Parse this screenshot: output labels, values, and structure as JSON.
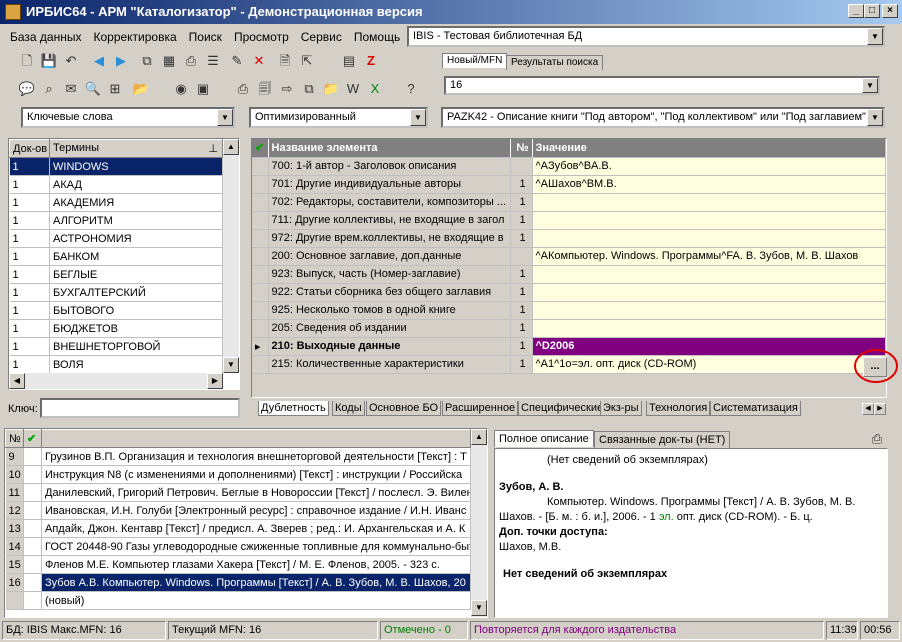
{
  "window": {
    "title": "ИРБИС64 - АРМ \"Каталогизатор\" - Демонстрационная версия"
  },
  "menu": [
    "База данных",
    "Корректировка",
    "Поиск",
    "Просмотр",
    "Сервис",
    "Помощь"
  ],
  "database": "IBIS - Тестовая библиотечная БД",
  "mfn_tabs": [
    "Новый/MFN",
    "Результаты поиска"
  ],
  "mfn_value": "16",
  "search_type": "Ключевые слова",
  "mode": "Оптимизированный",
  "worksheet": "PAZK42 - Описание книги \"Под автором\", \"Под коллективом\" или \"Под заглавием\"",
  "dict": {
    "headers": [
      "Док-ов",
      "Термины"
    ],
    "rows": [
      [
        "1",
        "WINDOWS"
      ],
      [
        "1",
        "АКАД"
      ],
      [
        "1",
        "АКАДЕМИЯ"
      ],
      [
        "1",
        "АЛГОРИТМ"
      ],
      [
        "1",
        "АСТРОНОМИЯ"
      ],
      [
        "1",
        "БАНКОМ"
      ],
      [
        "1",
        "БЕГЛЫЕ"
      ],
      [
        "1",
        "БУХГАЛТЕРСКИЙ"
      ],
      [
        "1",
        "БЫТОВОГО"
      ],
      [
        "1",
        "БЮДЖЕТОВ"
      ],
      [
        "1",
        "ВНЕШНЕТОРГОВОЙ"
      ],
      [
        "1",
        "ВОЛЯ"
      ]
    ],
    "key_label": "Ключ:"
  },
  "fields": {
    "headers": [
      "Название элемента",
      "№",
      "Значение"
    ],
    "rows": [
      {
        "name": "700: 1-й автор - Заголовок описания",
        "num": "",
        "value": "^AЗубов^BA.B."
      },
      {
        "name": "701: Другие индивидуальные авторы",
        "num": "1",
        "value": "^AШахов^BM.B."
      },
      {
        "name": "702: Редакторы, составители, композиторы ...",
        "num": "1",
        "value": ""
      },
      {
        "name": "711: Другие коллективы, не входящие в загол",
        "num": "1",
        "value": ""
      },
      {
        "name": "972: Другие врем.коллективы, не входящие в",
        "num": "1",
        "value": ""
      },
      {
        "name": "200: Основное заглавие, доп.данные",
        "num": "",
        "value": "^AКомпьютер. Windows. Программы^FA. B. Зубов, M. B. Шахов"
      },
      {
        "name": "923: Выпуск, часть (Номер-заглавие)",
        "num": "1",
        "value": ""
      },
      {
        "name": "922: Статьи сборника без общего заглавия",
        "num": "1",
        "value": ""
      },
      {
        "name": "925: Несколько томов в одной книге",
        "num": "1",
        "value": ""
      },
      {
        "name": "205: Сведения об издании",
        "num": "1",
        "value": ""
      },
      {
        "name": "210: Выходные данные",
        "num": "1",
        "value": "^D2006"
      },
      {
        "name": "215: Количественные характеристики",
        "num": "1",
        "value": "^A1^1о=эл. опт. диск (CD-ROM)"
      }
    ],
    "ellipsis": "..."
  },
  "bottom_tabs": [
    "Дублетность",
    "Коды",
    "Основное БО",
    "Расширенное",
    "Специфические",
    "Экз-ры",
    "Технология",
    "Систематизация"
  ],
  "records": {
    "headers": [
      "№"
    ],
    "rows": [
      [
        "9",
        "Грузинов В.П. Организация и технология внешнеторговой деятельности [Текст] : Т"
      ],
      [
        "10",
        "Инструкция N8   (с изменениями и дополнениями) [Текст] : инструкции / Российска"
      ],
      [
        "11",
        "Данилевский, Григорий Петрович. Беглые в Новороссии [Текст] / послесл. Э. Вилен"
      ],
      [
        "12",
        "Ивановская, И.Н. Голуби [Электронный ресурс] : справочное издание / И.Н. Иванс"
      ],
      [
        "13",
        "Апдайк, Джон. Кентавр [Текст] / предисл. А. Зверев ; ред.: И. Архангельская и А. К"
      ],
      [
        "14",
        "ГОСТ 20448-90 Газы углеводородные сжиженные топливные для коммунально-быт"
      ],
      [
        "15",
        "Фленов М.Е. Компьютер глазами Хакера [Текст] / М. Е. Фленов, 2005. - 323 с."
      ],
      [
        "16",
        "Зубов А.В. Компьютер. Windows. Программы [Текст] / А. В. Зубов, М. В. Шахов, 20"
      ],
      [
        "",
        "(новый)"
      ]
    ]
  },
  "desc_tabs": [
    "Полное описание",
    "Связанные док-ты (НЕТ)"
  ],
  "description": {
    "no_copies_top": "(Нет сведений об экземплярах)",
    "author": "Зубов, А. В.",
    "body1": "Компьютер. Windows. Программы [Текст] / А. В. Зубов, М. В.",
    "body2a": "Шахов. - [Б. м. : б. и.], 2006. - 1 ",
    "body2b": "эл.",
    "body2c": " опт. диск (CD-ROM). - Б. ц.",
    "access_label": "Доп. точки доступа:",
    "access_value": "Шахов, М.В.",
    "no_copies": "Нет сведений об экземплярах"
  },
  "status": {
    "db": "БД: IBIS Макс.MFN: 16",
    "current": "Текущий MFN: 16",
    "marked": "Отмечено - 0",
    "repeat": "Повторяется для каждого издательства",
    "time": "11:39",
    "time2": "00:56"
  },
  "colors": {
    "selected": "#0a246a",
    "field_selected": "#800080",
    "value_bg": "#ffffe0",
    "marked": "#008000",
    "repeat": "#800080",
    "highlight_circle": "#e00000"
  }
}
